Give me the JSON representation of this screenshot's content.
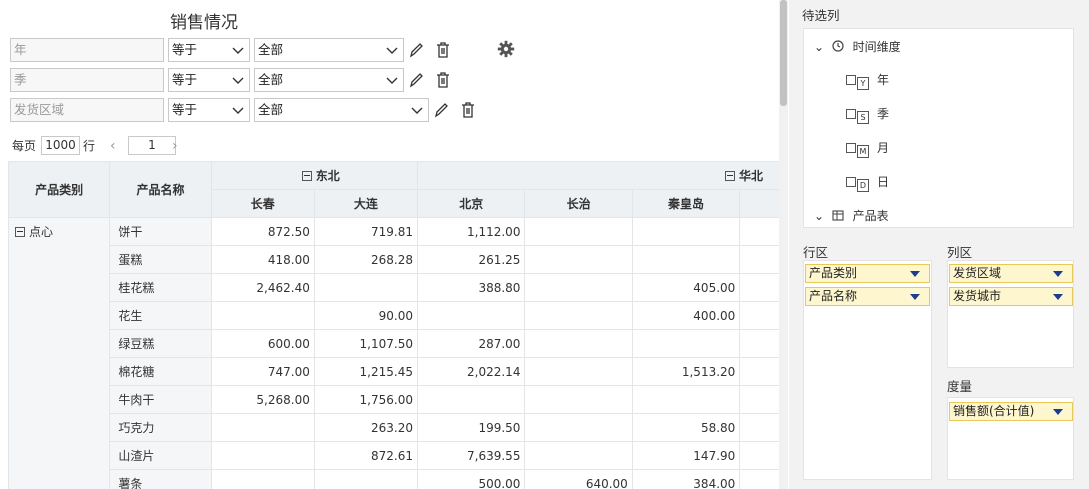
{
  "title": "销售情况",
  "filters": [
    {
      "name": "年",
      "op": "等于",
      "value": "全部"
    },
    {
      "name": "季",
      "op": "等于",
      "value": "全部"
    },
    {
      "name": "发货区域",
      "op": "等于",
      "value": "全部"
    }
  ],
  "pager": {
    "per_page_label": "每页",
    "page_size": "1000",
    "rows_label": "行",
    "current_page": "1",
    "prev": "‹",
    "next": "›"
  },
  "table": {
    "row_headers": [
      "产品类别",
      "产品名称"
    ],
    "groups": [
      {
        "label": "东北"
      },
      {
        "label": "华北"
      }
    ],
    "cities": [
      "长春",
      "大连",
      "北京",
      "长治",
      "秦皇岛"
    ],
    "category": "点心",
    "rows": [
      {
        "name": "饼干",
        "values": [
          "872.50",
          "719.81",
          "1,112.00",
          "",
          ""
        ]
      },
      {
        "name": "蛋糕",
        "values": [
          "418.00",
          "268.28",
          "261.25",
          "",
          ""
        ]
      },
      {
        "name": "桂花糕",
        "values": [
          "2,462.40",
          "",
          "388.80",
          "",
          "405.00"
        ]
      },
      {
        "name": "花生",
        "values": [
          "",
          "90.00",
          "",
          "",
          "400.00"
        ]
      },
      {
        "name": "绿豆糕",
        "values": [
          "600.00",
          "1,107.50",
          "287.00",
          "",
          ""
        ]
      },
      {
        "name": "棉花糖",
        "values": [
          "747.00",
          "1,215.45",
          "2,022.14",
          "",
          "1,513.20"
        ]
      },
      {
        "name": "牛肉干",
        "values": [
          "5,268.00",
          "1,756.00",
          "",
          "",
          ""
        ]
      },
      {
        "name": "巧克力",
        "values": [
          "",
          "263.20",
          "199.50",
          "",
          "58.80"
        ]
      },
      {
        "name": "山渣片",
        "values": [
          "",
          "872.61",
          "7,639.55",
          "",
          "147.90"
        ]
      },
      {
        "name": "薯条",
        "values": [
          "",
          "",
          "500.00",
          "640.00",
          "384.00"
        ]
      }
    ]
  },
  "panel": {
    "pending_title": "待选列",
    "tree": {
      "time_dim": "时间维度",
      "items": [
        {
          "tag": "Y",
          "label": "年"
        },
        {
          "tag": "S",
          "label": "季"
        },
        {
          "tag": "M",
          "label": "月"
        },
        {
          "tag": "D",
          "label": "日"
        }
      ],
      "product_table": "产品表"
    },
    "row_zone_title": "行区",
    "col_zone_title": "列区",
    "measure_title": "度量",
    "row_fields": [
      "产品类别",
      "产品名称"
    ],
    "col_fields": [
      "发货区域",
      "发货城市"
    ],
    "measures": [
      "销售额(合计值)"
    ]
  }
}
